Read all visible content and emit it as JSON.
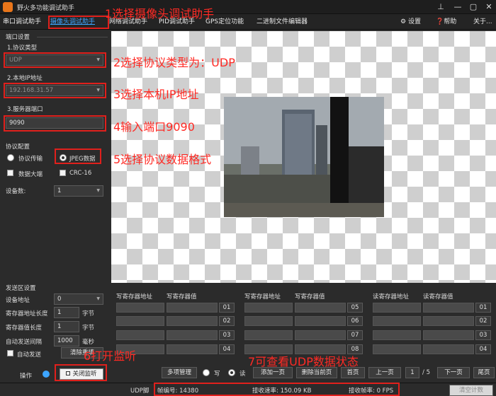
{
  "window": {
    "title": "野火多功能调试助手"
  },
  "menu": {
    "items": [
      "串口调试助手",
      "摄像头调试助手",
      "网络调试助手",
      "PID调试助手",
      "GPS定位功能",
      "二进制文件编辑器"
    ],
    "settings": "设置",
    "help": "帮助",
    "about": "关于..."
  },
  "port": {
    "group_title": "端口设置",
    "protocol_label": "1.协议类型",
    "protocol_value": "UDP",
    "ip_label": "2.本地IP地址",
    "ip_value": "192.168.31.57",
    "server_port_label": "3.服务器端口",
    "server_port_value": "9090"
  },
  "protocol_cfg": {
    "group_title": "协议配置",
    "opt_protocol": "协议传输",
    "opt_jpeg": "JPEG数据",
    "big_endian": "数据大端",
    "crc": "CRC-16",
    "device_count_label": "设备数:",
    "device_count_value": "1"
  },
  "send": {
    "group_title": "发送区设置",
    "dev_addr_label": "设备地址",
    "dev_addr_value": "0",
    "reg_addr_len_label": "寄存器地址长度",
    "reg_addr_len_value": "1",
    "reg_addr_len_unit": "字节",
    "reg_val_len_label": "寄存器值长度",
    "reg_val_len_value": "1",
    "reg_val_len_unit": "字节",
    "interval_label": "自动发送间隔",
    "interval_value": "1000",
    "interval_unit": "毫秒",
    "auto_send": "自动发送",
    "clear_button": "清除重填"
  },
  "op": {
    "label": "操作",
    "close_button": "关闭监听"
  },
  "registers": {
    "write_addr": "写寄存器地址",
    "write_value": "写寄存器值",
    "read_addr": "读寄存器地址",
    "read_value": "读寄存器值",
    "col1_rows": [
      "01",
      "02",
      "03",
      "04"
    ],
    "col2_rows": [
      "05",
      "06",
      "07",
      "08"
    ],
    "col3_rows": [
      "01",
      "02",
      "03",
      "04"
    ]
  },
  "pager": {
    "multi": "多项管理",
    "write": "写",
    "read": "读",
    "add_page": "添加一页",
    "delete_page": "删除当前页",
    "first": "首页",
    "prev": "上一页",
    "current": "1",
    "total": "/ 5",
    "next": "下一页",
    "last": "尾页"
  },
  "status": {
    "mode": "UDP脚",
    "frame": "帧编号: 14380",
    "rate": "接收速率: 150.09 KB",
    "fps": "接收帧率: 0 FPS",
    "clear_count": "清空计数"
  },
  "annotations": {
    "a1": "1选择摄像头调试助手",
    "a2": "2选择协议类型为：UDP",
    "a3": "3选择本机IP地址",
    "a4": "4输入端口9090",
    "a5": "5选择协议数据格式",
    "a6": "6打开监听",
    "a7": "7可查看UDP数据状态"
  },
  "colors": {
    "annotation": "#e0201c",
    "active_tab": "#3da5ff"
  }
}
